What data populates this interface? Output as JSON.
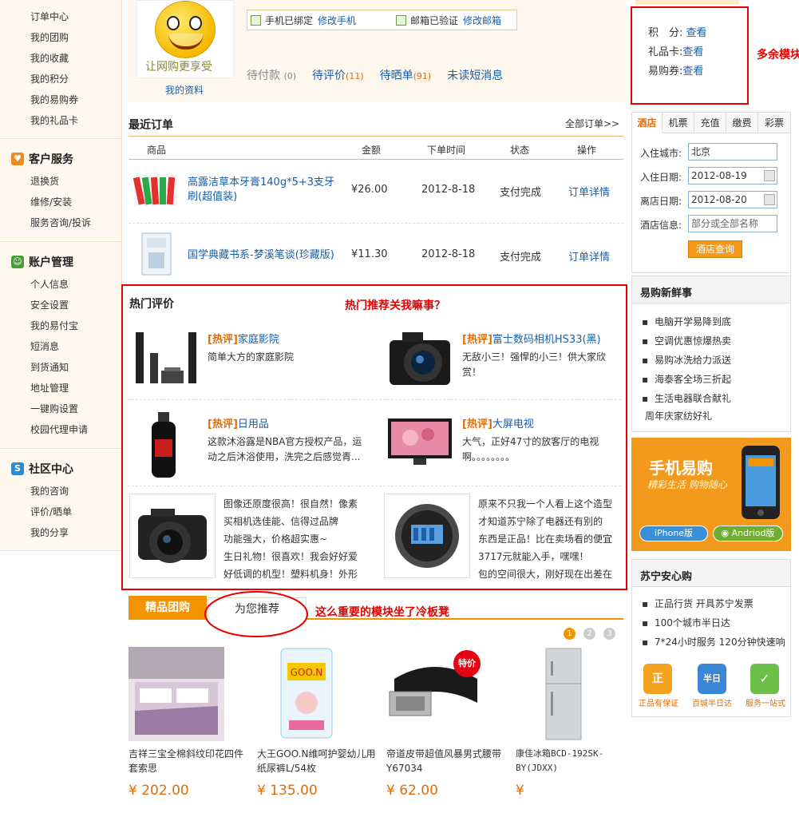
{
  "leftnav": {
    "top_items": [
      "订单中心",
      "我的团购",
      "我的收藏",
      "我的积分",
      "我的易购券",
      "我的礼品卡"
    ],
    "sections": [
      {
        "title": "客户服务",
        "icon": "heart-icon",
        "items": [
          "退换货",
          "维修/安装",
          "服务咨询/投诉"
        ]
      },
      {
        "title": "账户管理",
        "icon": "user-icon",
        "items": [
          "个人信息",
          "安全设置",
          "我的易付宝",
          "短消息",
          "到货通知",
          "地址管理",
          "一键购设置",
          "校园代理申请"
        ]
      },
      {
        "title": "社区中心",
        "icon": "community-icon",
        "items": [
          "我的咨询",
          "评价/晒单",
          "我的分享"
        ]
      }
    ]
  },
  "profile": {
    "avatar_text": "让网购更享受",
    "my_profile": "我的资料",
    "phone_status": "手机已绑定",
    "phone_link": "修改手机",
    "email_status": "邮箱已验证",
    "email_link": "修改邮箱",
    "order_status": [
      {
        "label": "待付款",
        "count": "(0)"
      },
      {
        "label": "待评价",
        "count": "(11)"
      },
      {
        "label": "待晒单",
        "count": "(91)"
      },
      {
        "label": "未读短消息",
        "count": ""
      }
    ]
  },
  "points": {
    "rows": [
      {
        "label": "积　分:",
        "link": "查看"
      },
      {
        "label": "礼品卡:",
        "link": "查看"
      },
      {
        "label": "易购券:",
        "link": "查看"
      }
    ],
    "annotation": "多余模块"
  },
  "orders": {
    "title": "最近订单",
    "all_link": "全部订单>>",
    "headers": [
      "商品",
      "金额",
      "下单时间",
      "状态",
      "操作"
    ],
    "rows": [
      {
        "name": "高露洁草本牙膏140g*5+3支牙刷(超值装)",
        "price": "¥26.00",
        "date": "2012-8-18",
        "status": "支付完成",
        "action": "订单详情"
      },
      {
        "name": "国学典藏书系-梦溪笔谈(珍藏版)",
        "price": "¥11.30",
        "date": "2012-8-18",
        "status": "支付完成",
        "action": "订单详情"
      }
    ]
  },
  "hot": {
    "title": "热门评价",
    "annotation": "热门推荐关我嘛事？",
    "items": [
      {
        "tag": "[热评]",
        "name": "家庭影院",
        "desc": "简单大方的家庭影院"
      },
      {
        "tag": "[热评]",
        "name": "富士数码相机HS33(黑)",
        "desc": "无敌小三！强悍的小三！供大家欣赏！"
      },
      {
        "tag": "[热评]",
        "name": "日用品",
        "desc": "这款沐浴露是NBA官方授权产品，运动之后沐浴使用，洗完之后感觉青..."
      },
      {
        "tag": "[热评]",
        "name": "大屏电视",
        "desc": "大气，正好47寸的放客厅的电视啊。。。。。。。。"
      }
    ],
    "reviews": [
      {
        "lines": [
          "图像还原度很高！很自然！像素",
          "买相机选佳能、信得过品牌",
          "功能强大，价格超实惠~",
          "生日礼物！很喜欢！我会好好爱",
          "好低调的机型！塑料机身！外形"
        ]
      },
      {
        "lines": [
          "原来不只我一个人看上这个造型",
          "才知道苏宁除了电器还有别的",
          "东西是正品！比在卖场看的便宜",
          "3717元就能入手，嘿嘿！",
          "包的空间很大，刚好现在出差在"
        ]
      }
    ]
  },
  "recommend": {
    "tab_group": "精品团购",
    "tab_recommend": "为您推荐",
    "annotation": "这么重要的模块坐了冷板凳",
    "pages": [
      "1",
      "2",
      "3"
    ],
    "products": [
      {
        "name": "吉祥三宝全棉斜纹印花四件套索思",
        "price": "¥ 202.00"
      },
      {
        "name": "大王GOO.N维呵护婴幼儿用纸尿裤L/54枚",
        "price": "¥ 135.00"
      },
      {
        "name": "帝道皮带超值风暴男式腰带Y67034",
        "price": "¥ 62.00",
        "badge": "特价"
      },
      {
        "name": "康佳冰箱BCD-192SK-BY(JDXX)",
        "price": "¥"
      }
    ]
  },
  "booking": {
    "tabs": [
      "酒店",
      "机票",
      "充值",
      "缴费",
      "彩票"
    ],
    "fields": [
      {
        "label": "入住城市:",
        "value": "北京"
      },
      {
        "label": "入住日期:",
        "value": "2012-08-19"
      },
      {
        "label": "离店日期:",
        "value": "2012-08-20"
      },
      {
        "label": "酒店信息:",
        "value": "部分或全部名称"
      }
    ],
    "button": "酒店查询"
  },
  "news": {
    "title": "易购新鲜事",
    "items": [
      "电脑开学易降到底",
      "空调优惠惊爆热卖",
      "易购冰洗给力派送",
      "海泰客全场三折起",
      "生活电器联合献礼"
    ],
    "link": "周年庆家纺好礼"
  },
  "mobile": {
    "title": "手机易购",
    "slogan": "精彩生活 购物随心",
    "iphone": "iPhone版",
    "android": "Andriod版"
  },
  "assure": {
    "title": "苏宁安心购",
    "items": [
      "正品行货 开具苏宁发票",
      "100个城市半日达",
      "7*24小时服务 120分钟快速响"
    ],
    "badges": [
      {
        "glyph": "正",
        "label": "正品有保证"
      },
      {
        "glyph": "半日",
        "label": "百城半日达"
      },
      {
        "glyph": "✓",
        "label": "服务一站式"
      }
    ]
  },
  "colors": {
    "accent": "#f29400",
    "link": "#1a5ea8",
    "alert": "#e60000"
  }
}
